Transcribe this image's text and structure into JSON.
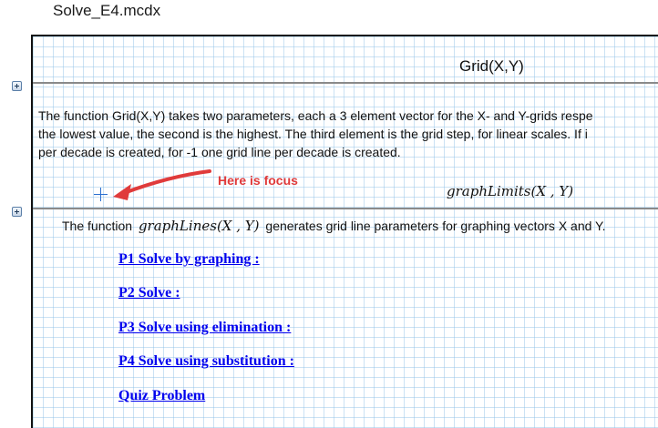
{
  "document": {
    "tab_title": "Solve_E4.mcdx"
  },
  "region1": {
    "title": "Grid(X,Y)",
    "paragraph": [
      "The function Grid(X,Y) takes two parameters, each a 3 element vector for the X- and Y-grids respe",
      "the lowest value, the second is the highest. The third element is the grid step, for linear scales. If i",
      "per decade is created, for -1 one grid line per decade is created."
    ],
    "annotation_text": "Here is focus",
    "math_fn": "graphLimits",
    "math_args": "(X , Y)"
  },
  "region2": {
    "text_before": "The function",
    "math_fn": "graphLines",
    "math_args": "(X , Y)",
    "text_after": "generates grid line parameters for graphing vectors X and Y.",
    "links": [
      "P1 Solve by graphing :",
      "P2 Solve :",
      "P3 Solve using elimination :",
      "P4 Solve using substitution :",
      "Quiz Problem"
    ]
  },
  "colors": {
    "grid": "#8cbee6",
    "annotation": "#e03b3b",
    "link": "#0000ee",
    "focus_cursor": "#2b6fd0"
  }
}
